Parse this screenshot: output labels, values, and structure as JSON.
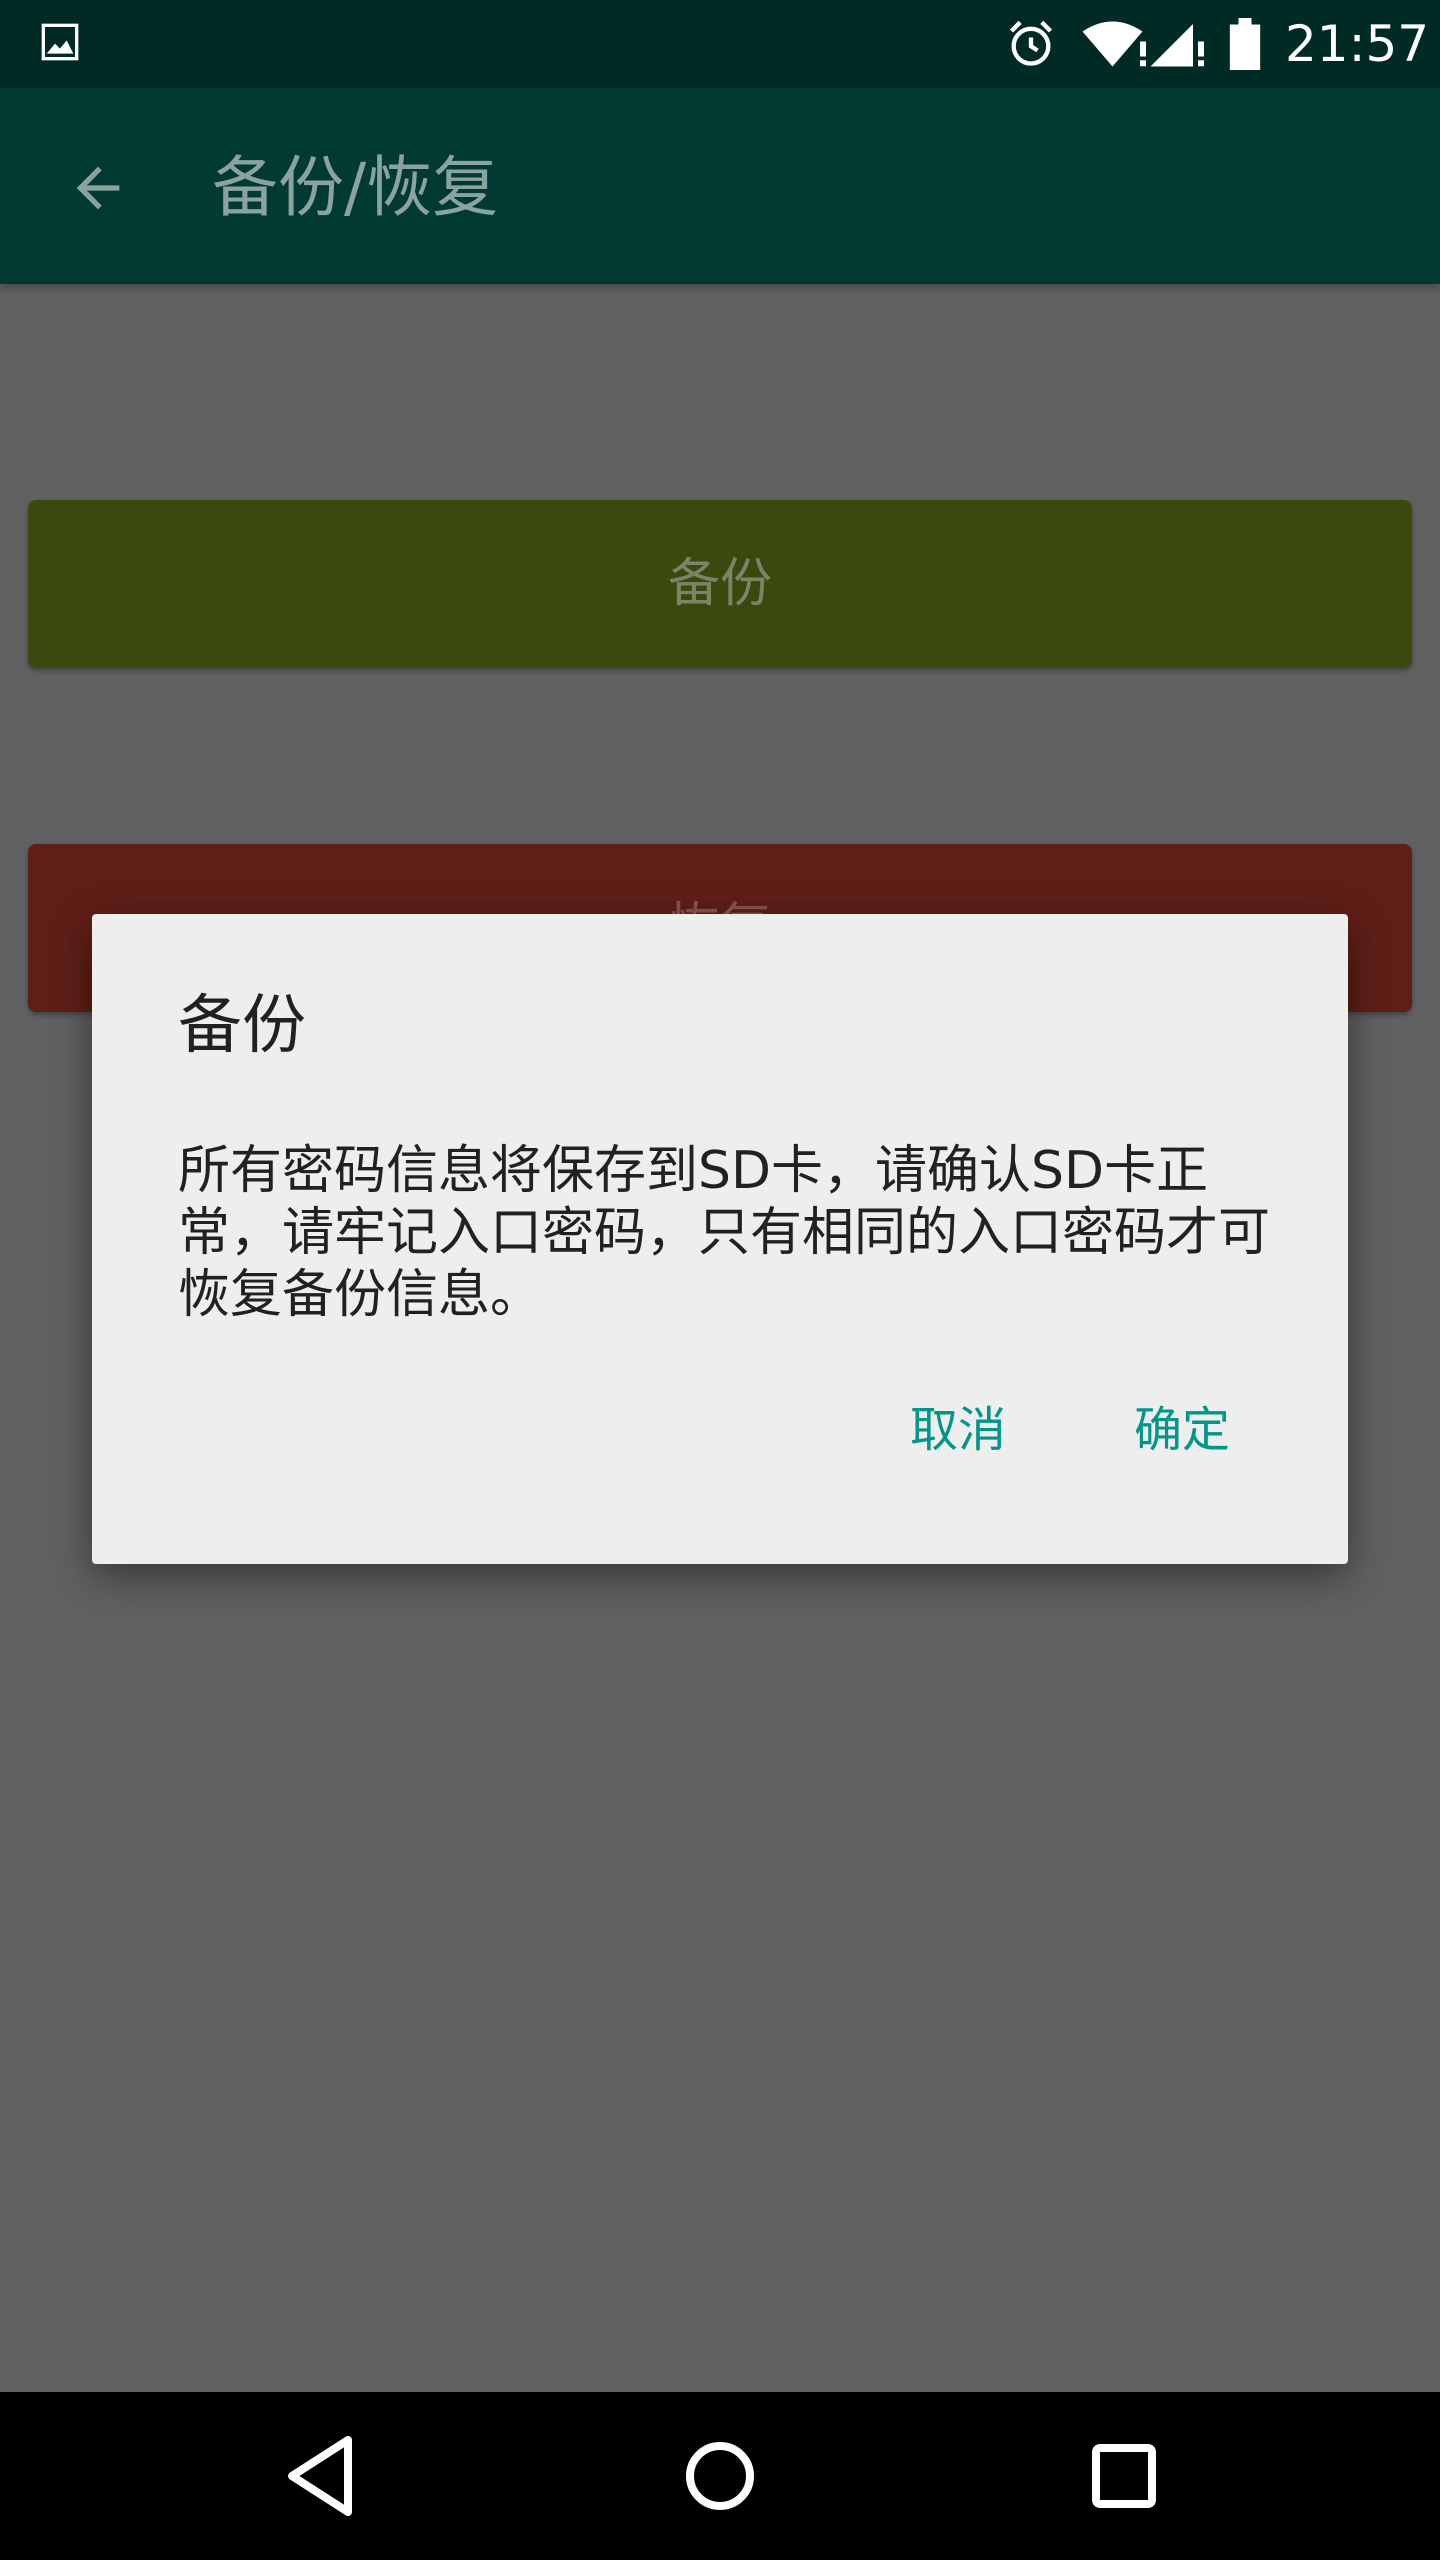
{
  "status_bar": {
    "time": "21:57",
    "icons": [
      "image-notification-icon",
      "alarm-icon",
      "wifi-icon",
      "signal-icon",
      "battery-icon"
    ]
  },
  "toolbar": {
    "title": "备份/恢复",
    "back_icon": "back-arrow-icon"
  },
  "page": {
    "backup_button_label": "备份",
    "restore_button_label": "恢复"
  },
  "dialog": {
    "title": "备份",
    "message": "所有密码信息将保存到SD卡，请确认SD卡正常，请牢记入口密码，只有相同的入口密码才可恢复备份信息。",
    "cancel_label": "取消",
    "confirm_label": "确定"
  },
  "nav_bar": {
    "icons": [
      "nav-back-icon",
      "nav-home-icon",
      "nav-recents-icon"
    ]
  },
  "colors": {
    "status_bar": "#002a24",
    "toolbar": "#003a33",
    "backup_button": "#3a4a0f",
    "restore_button": "#5f1f18",
    "dialog_bg": "#eeeeee",
    "accent": "#009688",
    "scrim_bg": "#616161",
    "nav_bar": "#000000"
  }
}
